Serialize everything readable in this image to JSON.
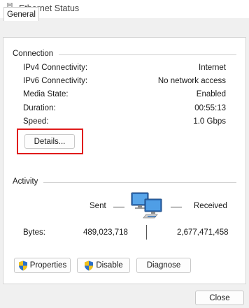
{
  "window": {
    "title": "Ethernet Status"
  },
  "tabs": [
    {
      "label": "General"
    }
  ],
  "connection": {
    "title": "Connection",
    "rows": [
      {
        "label": "IPv4 Connectivity:",
        "value": "Internet"
      },
      {
        "label": "IPv6 Connectivity:",
        "value": "No network access"
      },
      {
        "label": "Media State:",
        "value": "Enabled"
      },
      {
        "label": "Duration:",
        "value": "00:55:13"
      },
      {
        "label": "Speed:",
        "value": "1.0 Gbps"
      }
    ],
    "details_label": "Details..."
  },
  "activity": {
    "title": "Activity",
    "sent_label": "Sent",
    "received_label": "Received",
    "bytes_label": "Bytes:",
    "bytes_sent": "489,023,718",
    "bytes_received": "2,677,471,458"
  },
  "actions": {
    "properties_label": "Properties",
    "disable_label": "Disable",
    "diagnose_label": "Diagnose"
  },
  "footer": {
    "close_label": "Close"
  },
  "colors": {
    "highlight": "#e01b1b",
    "window_bg": "#f0f0f0",
    "panel_bg": "#ffffff"
  }
}
